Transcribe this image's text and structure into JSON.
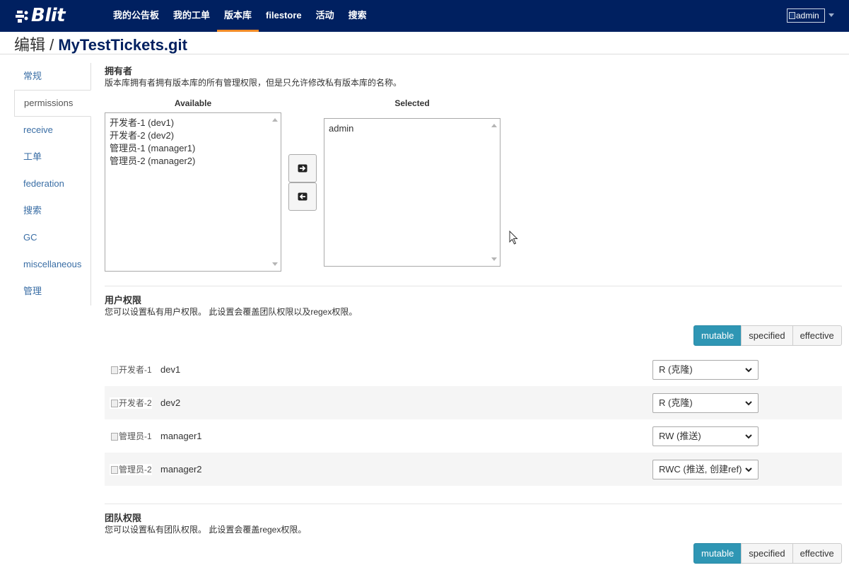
{
  "navbar": {
    "brand": "Blit",
    "items": [
      {
        "label": "我的公告板"
      },
      {
        "label": "我的工单"
      },
      {
        "label": "版本库"
      },
      {
        "label": "filestore"
      },
      {
        "label": "活动"
      },
      {
        "label": "搜索"
      }
    ],
    "active_index": 2,
    "user_avatar_alt": "admin"
  },
  "header": {
    "edit_label": "编辑 / ",
    "repo_name": "MyTestTickets.git"
  },
  "sidebar": {
    "items": [
      {
        "label": "常规"
      },
      {
        "label": "permissions"
      },
      {
        "label": "receive"
      },
      {
        "label": "工单"
      },
      {
        "label": "federation"
      },
      {
        "label": "搜索"
      },
      {
        "label": "GC"
      },
      {
        "label": "miscellaneous"
      },
      {
        "label": "管理"
      }
    ],
    "active_index": 1
  },
  "owners": {
    "title": "拥有者",
    "description": "版本库拥有者拥有版本库的所有管理权限，但是只允许修改私有版本库的名称。",
    "available_label": "Available",
    "selected_label": "Selected",
    "available": [
      "开发者-1 (dev1)",
      "开发者-2 (dev2)",
      "管理员-1 (manager1)",
      "管理员-2 (manager2)"
    ],
    "selected": [
      "admin"
    ]
  },
  "user_permissions": {
    "title": "用户权限",
    "description": "您可以设置私有用户权限。 此设置会覆盖团队权限以及regex权限。",
    "view_modes": [
      "mutable",
      "specified",
      "effective"
    ],
    "active_mode": "mutable",
    "rows": [
      {
        "avatar_alt": "开发者-1",
        "username": "dev1",
        "permission": "R (克隆)"
      },
      {
        "avatar_alt": "开发者-2",
        "username": "dev2",
        "permission": "R (克隆)"
      },
      {
        "avatar_alt": "管理员-1",
        "username": "manager1",
        "permission": "RW (推送)"
      },
      {
        "avatar_alt": "管理员-2",
        "username": "manager2",
        "permission": "RWC (推送, 创建ref)"
      }
    ]
  },
  "team_permissions": {
    "title": "团队权限",
    "description": "您可以设置私有团队权限。 此设置会覆盖regex权限。",
    "view_modes": [
      "mutable",
      "specified",
      "effective"
    ],
    "active_mode": "mutable"
  },
  "icons": {
    "move_right": "arrow-right-icon",
    "move_left": "arrow-left-icon",
    "dropdown": "chevron-down-icon",
    "cursor": "mouse-pointer-icon"
  },
  "colors": {
    "navbar_bg": "#002060",
    "nav_active_underline": "#f28c28",
    "link": "#3a6ea5",
    "active_button": "#2f96b4"
  }
}
